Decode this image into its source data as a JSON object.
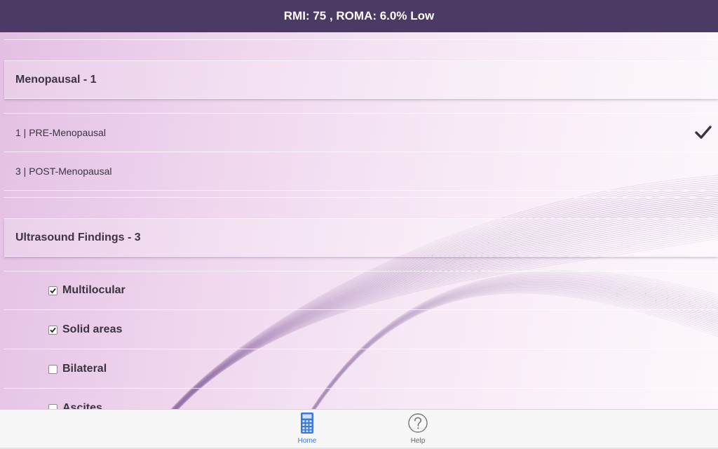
{
  "header": {
    "title": "RMI: 75 , ROMA: 6.0% Low"
  },
  "menopausal": {
    "title": "Menopausal - 1",
    "options": [
      {
        "label": "1 | PRE-Menopausal",
        "selected": true
      },
      {
        "label": "3 | POST-Menopausal",
        "selected": false
      }
    ]
  },
  "ultrasound": {
    "title": "Ultrasound Findings - 3",
    "items": [
      {
        "label": "Multilocular",
        "checked": true
      },
      {
        "label": "Solid areas",
        "checked": true
      },
      {
        "label": "Bilateral",
        "checked": false
      },
      {
        "label": "Ascites",
        "checked": false
      }
    ]
  },
  "tabs": {
    "home": "Home",
    "help": "Help"
  },
  "colors": {
    "header_bg": "#4b3a63",
    "active_tab": "#3c78d8"
  },
  "icons": {
    "selected": "checkmark-icon",
    "home": "calculator-icon",
    "help": "question-circle-icon"
  }
}
